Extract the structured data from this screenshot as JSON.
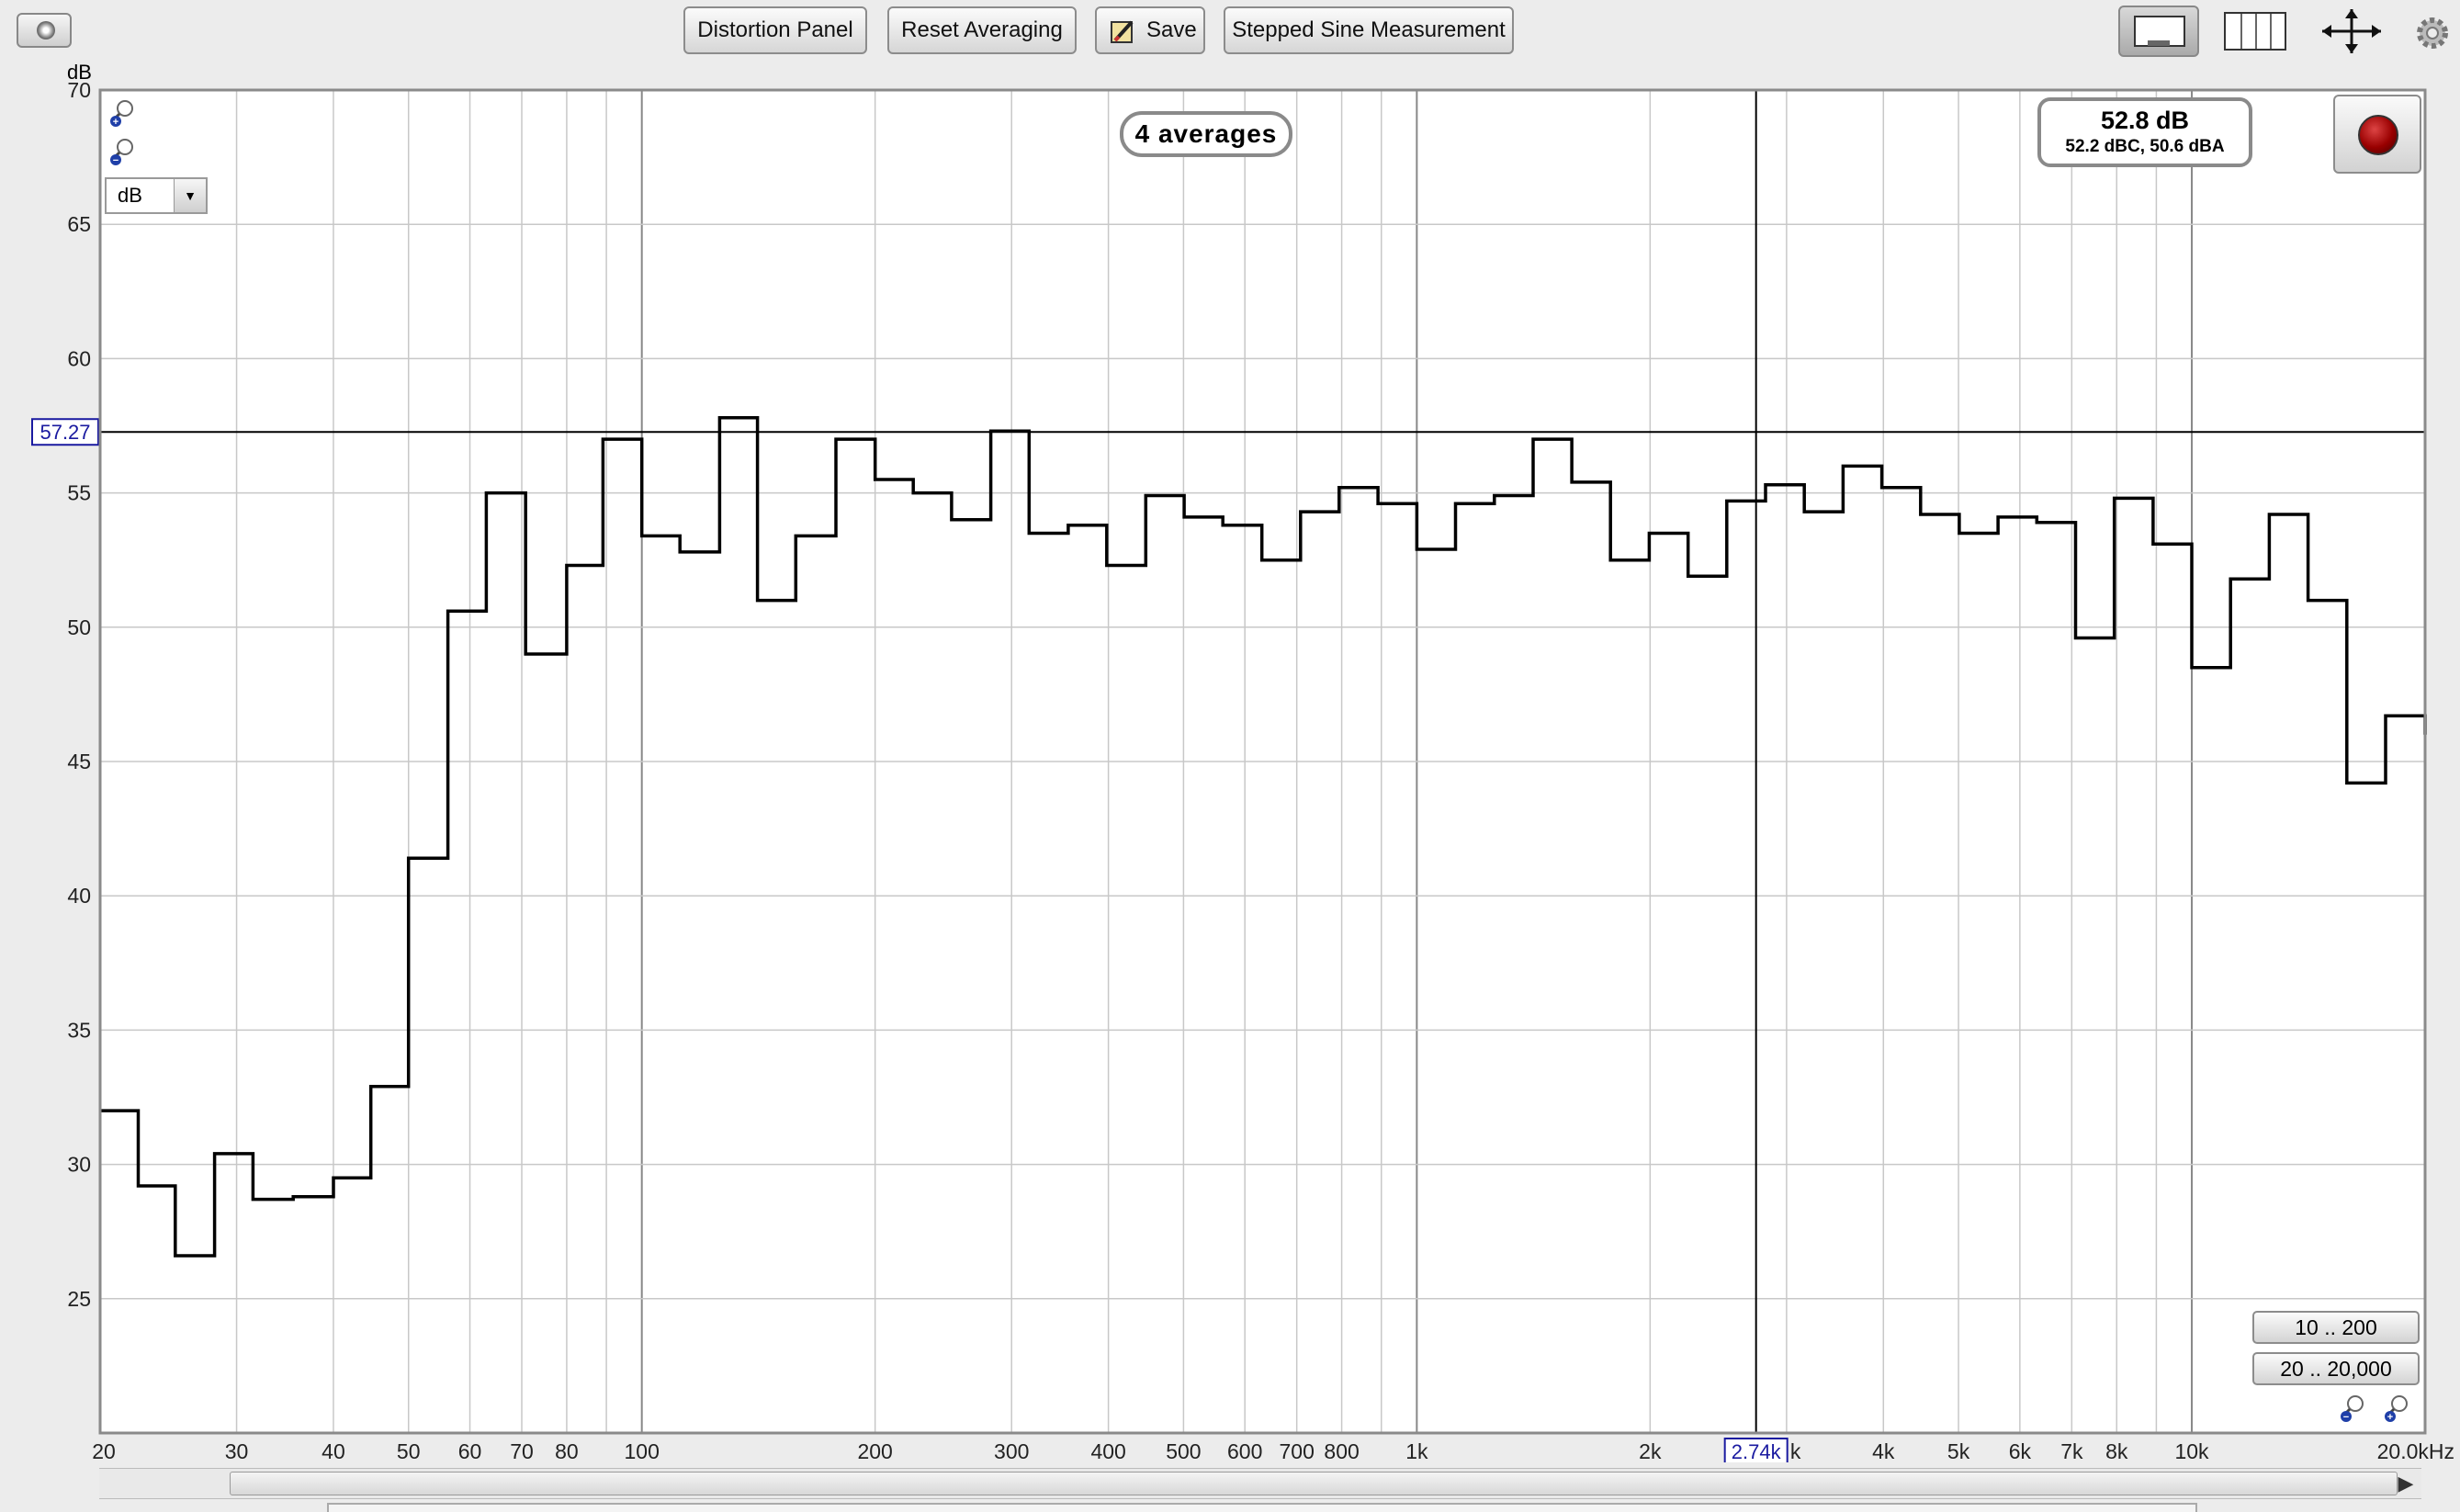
{
  "toolbar": {
    "distortion_panel": "Distortion Panel",
    "reset_averaging": "Reset Averaging",
    "save": "Save",
    "stepped_sine": "Stepped Sine Measurement"
  },
  "averages_badge": "4 averages",
  "spl_readout": {
    "main": "52.8 dB",
    "sub": "52.2 dBC, 50.6 dBA"
  },
  "unit_select": {
    "value": "dB"
  },
  "range_buttons": {
    "r1": "10 .. 200",
    "r2": "20 .. 20,000"
  },
  "cursor": {
    "y_value": 57.27,
    "y_label": "57.27",
    "x_value": 2740,
    "x_label": "2.74k"
  },
  "colors": {
    "trace": "#000000",
    "grid": "#c8c8c8",
    "plot_bg": "#ffffff",
    "cursor_label": "#1a1aa0"
  },
  "chart_data": {
    "type": "line",
    "step": true,
    "xscale": "log",
    "xlim": [
      20,
      20000
    ],
    "ylim": [
      20,
      70
    ],
    "ylabel": "dB",
    "grid": true,
    "y_ticks": [
      25,
      30,
      35,
      40,
      45,
      50,
      55,
      60,
      65,
      70
    ],
    "x_ticks": [
      {
        "v": 20,
        "label": "20"
      },
      {
        "v": 30,
        "label": "30"
      },
      {
        "v": 40,
        "label": "40"
      },
      {
        "v": 50,
        "label": "50"
      },
      {
        "v": 60,
        "label": "60"
      },
      {
        "v": 70,
        "label": "70"
      },
      {
        "v": 80,
        "label": "80"
      },
      {
        "v": 100,
        "label": "100"
      },
      {
        "v": 200,
        "label": "200"
      },
      {
        "v": 300,
        "label": "300"
      },
      {
        "v": 400,
        "label": "400"
      },
      {
        "v": 500,
        "label": "500"
      },
      {
        "v": 600,
        "label": "600"
      },
      {
        "v": 700,
        "label": "700"
      },
      {
        "v": 800,
        "label": "800"
      },
      {
        "v": 1000,
        "label": "1k"
      },
      {
        "v": 2000,
        "label": "2k"
      },
      {
        "v": 3000,
        "label": "k"
      },
      {
        "v": 4000,
        "label": "4k"
      },
      {
        "v": 5000,
        "label": "5k"
      },
      {
        "v": 6000,
        "label": "6k"
      },
      {
        "v": 7000,
        "label": "7k"
      },
      {
        "v": 8000,
        "label": "8k"
      },
      {
        "v": 10000,
        "label": "10k"
      },
      {
        "v": 20000,
        "label": "20.0kHz"
      }
    ],
    "series": [
      {
        "x": [
          20,
          22.4,
          25,
          28.1,
          31.5,
          35.5,
          40,
          44.7,
          50,
          56.2,
          63,
          70.8,
          80,
          89.1,
          100,
          112,
          126,
          141,
          158,
          178,
          200,
          224,
          251,
          282,
          316,
          355,
          398,
          447,
          501,
          562,
          631,
          708,
          794,
          891,
          1000,
          1122,
          1259,
          1413,
          1585,
          1778,
          1995,
          2239,
          2512,
          2818,
          3162,
          3548,
          3981,
          4467,
          5012,
          5623,
          6310,
          7079,
          7943,
          8913,
          10000,
          11220,
          12589,
          14125,
          15849,
          17783,
          20000
        ],
        "y": [
          32.0,
          29.2,
          26.6,
          30.4,
          28.7,
          28.8,
          29.5,
          32.9,
          41.4,
          50.6,
          55.0,
          49.0,
          52.3,
          57.0,
          53.4,
          52.8,
          57.8,
          51.0,
          53.4,
          57.0,
          55.5,
          55.0,
          54.0,
          57.3,
          53.5,
          53.8,
          52.3,
          54.9,
          54.1,
          53.8,
          52.5,
          54.3,
          55.2,
          54.6,
          52.9,
          54.6,
          54.9,
          57.0,
          55.4,
          52.5,
          53.5,
          51.9,
          54.7,
          55.3,
          54.3,
          56.0,
          55.2,
          54.2,
          53.5,
          54.1,
          53.9,
          49.6,
          54.8,
          53.1,
          48.5,
          51.8,
          54.2,
          51.0,
          44.2,
          46.7,
          46.0
        ]
      }
    ]
  }
}
